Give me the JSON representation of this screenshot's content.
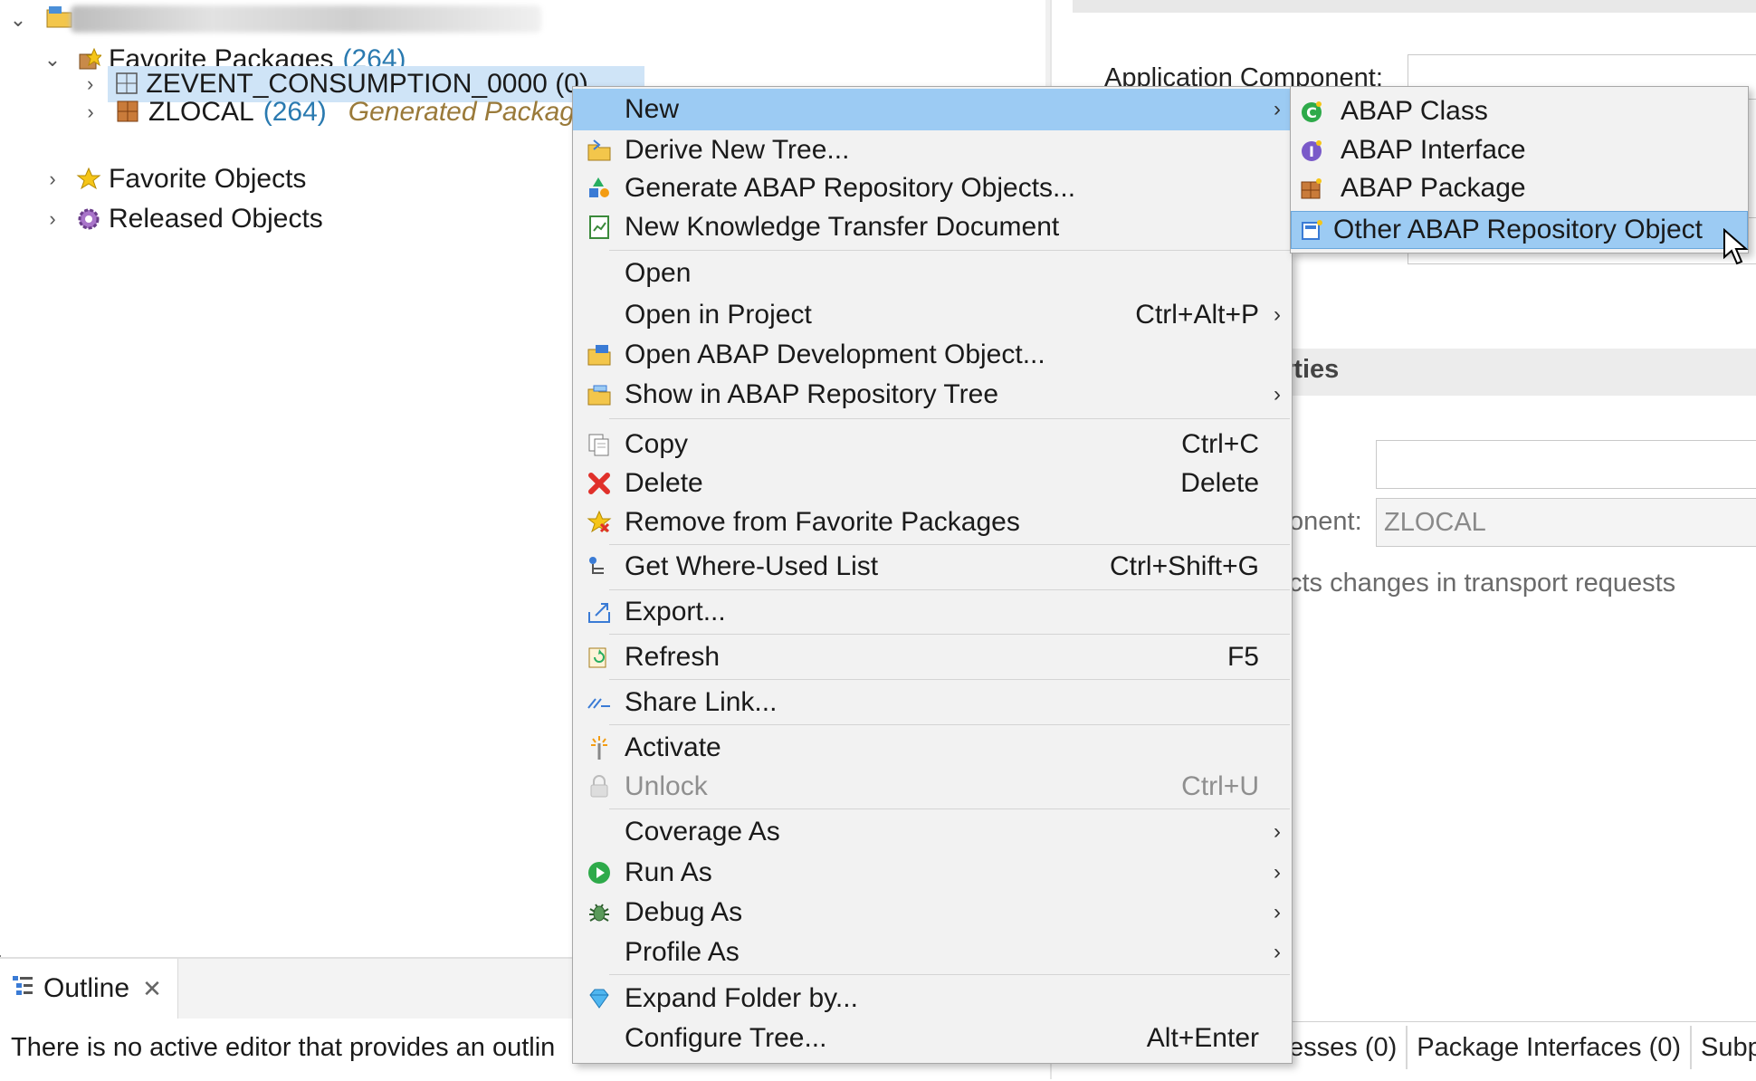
{
  "tree": {
    "items": [
      {
        "label": "Favorite Packages",
        "count": "(264)"
      },
      {
        "label": "ZEVENT_CONSUMPTION_0000 (0)"
      },
      {
        "label": "ZLOCAL",
        "count": "(264)",
        "description": "Generated Package f"
      },
      {
        "label": "Favorite Objects"
      },
      {
        "label": "Released Objects"
      }
    ]
  },
  "right_panel": {
    "application_component_label": "Application Component:",
    "section_title": "rties",
    "component_label": "onent:",
    "component_value": "ZLOCAL",
    "transport_text": "cts changes in transport requests",
    "tabs": [
      "esses (0)",
      "Package Interfaces (0)",
      "Subpa"
    ]
  },
  "outline": {
    "tab_label": "Outline",
    "message": "There is no active editor that provides an outlin"
  },
  "menu": {
    "new": "New",
    "derive_new_tree": "Derive New Tree...",
    "generate_objects": "Generate ABAP Repository Objects...",
    "new_ktd": "New Knowledge Transfer Document",
    "open": "Open",
    "open_in_project": "Open in Project",
    "open_in_project_key": "Ctrl+Alt+P",
    "open_dev_object": "Open ABAP Development Object...",
    "show_in_tree": "Show in ABAP Repository Tree",
    "copy": "Copy",
    "copy_key": "Ctrl+C",
    "delete": "Delete",
    "delete_key": "Delete",
    "remove_favorite": "Remove from Favorite Packages",
    "where_used": "Get Where-Used List",
    "where_used_key": "Ctrl+Shift+G",
    "export": "Export...",
    "refresh": "Refresh",
    "refresh_key": "F5",
    "share_link": "Share Link...",
    "activate": "Activate",
    "unlock": "Unlock",
    "unlock_key": "Ctrl+U",
    "coverage_as": "Coverage As",
    "run_as": "Run As",
    "debug_as": "Debug As",
    "profile_as": "Profile As",
    "expand_folder": "Expand Folder by...",
    "configure_tree": "Configure Tree...",
    "configure_tree_key": "Alt+Enter"
  },
  "submenu": {
    "abap_class": "ABAP Class",
    "abap_interface": "ABAP Interface",
    "abap_package": "ABAP Package",
    "other_object": "Other ABAP Repository Object"
  },
  "colors": {
    "highlight": "#9ccbf3",
    "selection": "#cfe4f7",
    "count_blue": "#2a7ab0",
    "description_brown": "#9a7a3a"
  }
}
